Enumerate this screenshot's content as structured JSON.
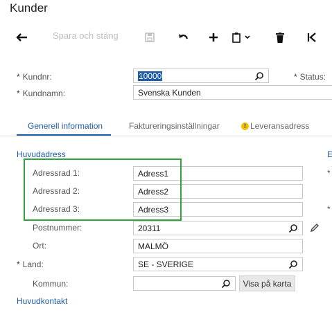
{
  "page": {
    "title": "Kunder"
  },
  "toolbar": {
    "save_close_label": "Spara och stäng",
    "buttons": [
      "back-arrow-icon",
      "save-icon",
      "undo-icon",
      "add-icon",
      "copy-paste-icon",
      "delete-icon",
      "first-record-icon"
    ]
  },
  "header": {
    "customer_no_label": "Kundnr:",
    "customer_no_value": "10000",
    "status_label": "Status:",
    "customer_name_label": "Kundnamn:",
    "customer_name_value": "Svenska Kunden",
    "required_marker": "*"
  },
  "tabs": [
    {
      "label": "Generell information",
      "active": true
    },
    {
      "label": "Faktureringsinställningar",
      "active": false
    },
    {
      "label": "Leveransadress",
      "active": false,
      "warning": true
    }
  ],
  "main_address": {
    "section_title": "Huvudadress",
    "address1_label": "Adressrad 1:",
    "address1_value": "Adress1",
    "address2_label": "Adressrad 2:",
    "address2_value": "Adress2",
    "address3_label": "Adressrad 3:",
    "address3_value": "Adress3",
    "postal_label": "Postnummer:",
    "postal_value": "20311",
    "city_label": "Ort:",
    "city_value": "MALMÖ",
    "country_label": "Land:",
    "country_value": "SE - SVERIGE",
    "municipality_label": "Kommun:",
    "municipality_value": "",
    "map_button": "Visa på karta"
  },
  "main_contact": {
    "section_title": "Huvudkontakt"
  },
  "right_column": {
    "section_letter": "E",
    "marker": "*"
  },
  "colors": {
    "accent": "#1f5da8",
    "highlight": "#2ea43a",
    "warning": "#f2c200"
  }
}
